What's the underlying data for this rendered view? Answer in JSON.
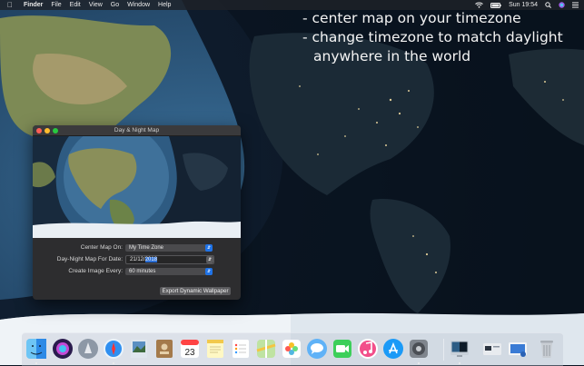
{
  "menubar": {
    "apple_icon": "apple-icon",
    "app_name": "Finder",
    "menus": [
      "File",
      "Edit",
      "View",
      "Go",
      "Window",
      "Help"
    ],
    "clock": "Sun 19:54"
  },
  "caption": {
    "line1": "- center map on your timezone",
    "line2": "- change timezone to match daylight",
    "line3": "anywhere in the world"
  },
  "window": {
    "title": "Day & Night Map",
    "center_label": "Center Map On:",
    "center_value": "My Time Zone",
    "date_label": "Day-Night Map For Date:",
    "date_prefix": "21/12/",
    "date_year": "2018",
    "interval_label": "Create Image Every:",
    "interval_value": "60 minutes",
    "export_label": "Export Dynamic Wallpaper"
  },
  "calendar": {
    "day": "23"
  },
  "dock": {
    "items": [
      "finder-icon",
      "siri-icon",
      "launchpad-icon",
      "safari-icon",
      "preview-icon",
      "contacts-icon",
      "calendar-icon",
      "notes-icon",
      "reminders-icon",
      "maps-icon",
      "photos-icon",
      "messages-icon",
      "facetime-icon",
      "itunes-icon",
      "app-store-icon",
      "system-preferences-icon",
      "day-night-map-app-icon",
      "card-icon",
      "screenshot-icon",
      "trash-icon"
    ]
  },
  "colors": {
    "accent": "#1f73e8",
    "night": "#0b1523",
    "ocean_day": "#2e5d86"
  }
}
